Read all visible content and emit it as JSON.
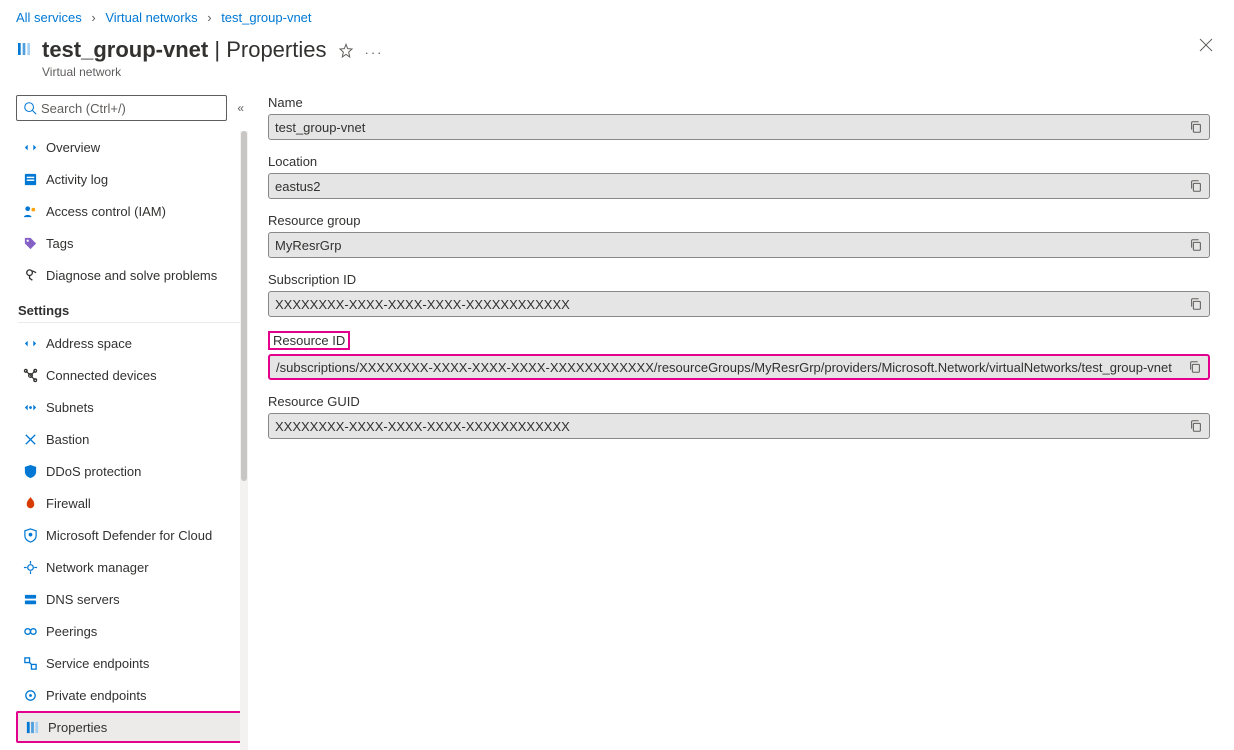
{
  "breadcrumb": {
    "items": [
      "All services",
      "Virtual networks",
      "test_group-vnet"
    ]
  },
  "header": {
    "title_resource": "test_group-vnet",
    "title_page": "Properties",
    "divider": " | ",
    "subtitle": "Virtual network"
  },
  "sidebar": {
    "search_placeholder": "Search (Ctrl+/)",
    "top_items": [
      {
        "label": "Overview",
        "icon": "overview"
      },
      {
        "label": "Activity log",
        "icon": "activity-log"
      },
      {
        "label": "Access control (IAM)",
        "icon": "iam"
      },
      {
        "label": "Tags",
        "icon": "tags"
      },
      {
        "label": "Diagnose and solve problems",
        "icon": "diagnose"
      }
    ],
    "settings_header": "Settings",
    "settings_items": [
      {
        "label": "Address space",
        "icon": "address-space"
      },
      {
        "label": "Connected devices",
        "icon": "connected-devices"
      },
      {
        "label": "Subnets",
        "icon": "subnets"
      },
      {
        "label": "Bastion",
        "icon": "bastion"
      },
      {
        "label": "DDoS protection",
        "icon": "ddos"
      },
      {
        "label": "Firewall",
        "icon": "firewall"
      },
      {
        "label": "Microsoft Defender for Cloud",
        "icon": "defender"
      },
      {
        "label": "Network manager",
        "icon": "network-manager"
      },
      {
        "label": "DNS servers",
        "icon": "dns"
      },
      {
        "label": "Peerings",
        "icon": "peerings"
      },
      {
        "label": "Service endpoints",
        "icon": "service-endpoints"
      },
      {
        "label": "Private endpoints",
        "icon": "private-endpoints"
      },
      {
        "label": "Properties",
        "icon": "properties",
        "selected": true,
        "highlighted": true
      }
    ]
  },
  "properties": {
    "fields": [
      {
        "label": "Name",
        "value": "test_group-vnet"
      },
      {
        "label": "Location",
        "value": "eastus2"
      },
      {
        "label": "Resource group",
        "value": "MyResrGrp"
      },
      {
        "label": "Subscription ID",
        "value": "XXXXXXXX-XXXX-XXXX-XXXX-XXXXXXXXXXXX"
      },
      {
        "label": "Resource ID",
        "value": "/subscriptions/XXXXXXXX-XXXX-XXXX-XXXX-XXXXXXXXXXXX/resourceGroups/MyResrGrp/providers/Microsoft.Network/virtualNetworks/test_group-vnet",
        "highlight_label": true,
        "highlight_box": true
      },
      {
        "label": "Resource GUID",
        "value": "XXXXXXXX-XXXX-XXXX-XXXX-XXXXXXXXXXXX"
      }
    ]
  }
}
